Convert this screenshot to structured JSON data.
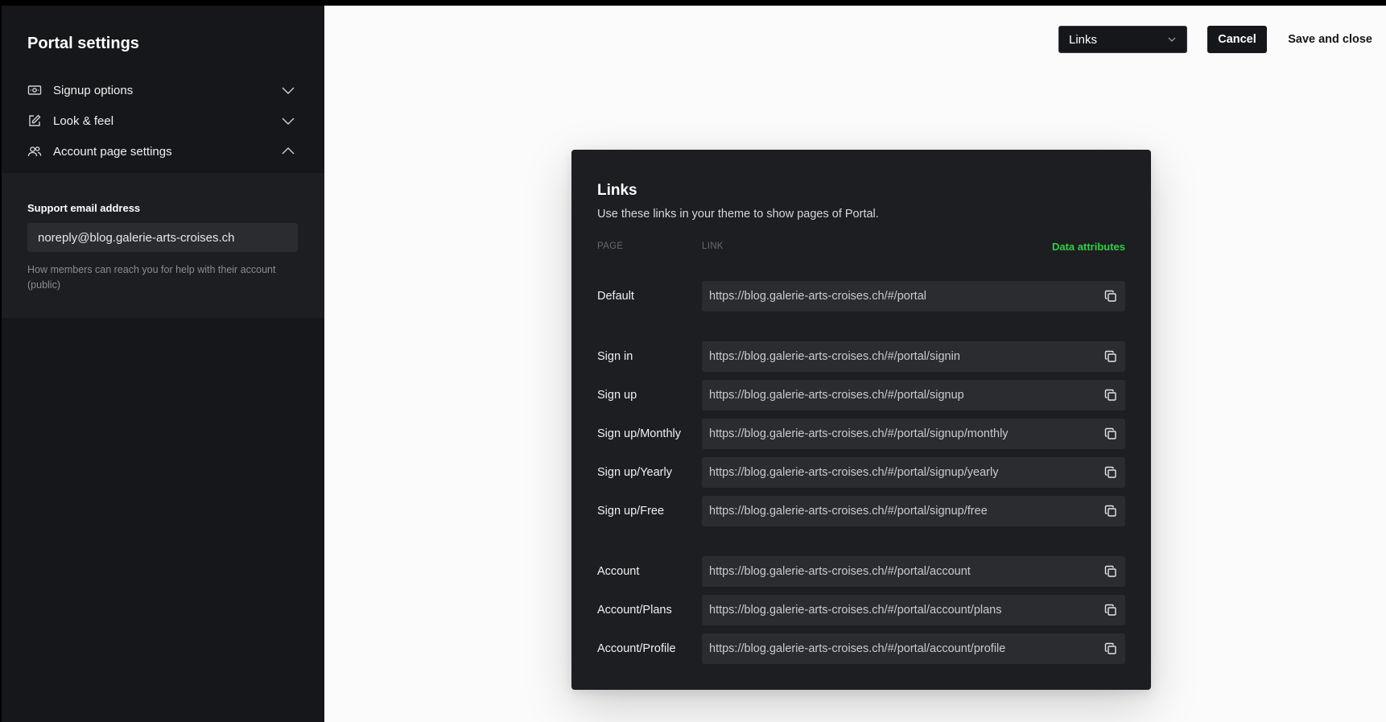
{
  "sidebar": {
    "title": "Portal settings",
    "items": [
      {
        "label": "Signup options",
        "icon": "card-icon",
        "expanded": false
      },
      {
        "label": "Look & feel",
        "icon": "edit-icon",
        "expanded": false
      },
      {
        "label": "Account page settings",
        "icon": "users-icon",
        "expanded": true
      }
    ],
    "support_email": {
      "label": "Support email address",
      "value": "noreply@blog.galerie-arts-croises.ch",
      "hint": "How members can reach you for help with their account (public)"
    }
  },
  "toolbar": {
    "select_value": "Links",
    "cancel_label": "Cancel",
    "save_label": "Save and close"
  },
  "modal": {
    "title": "Links",
    "subtitle": "Use these links in your theme to show pages of Portal.",
    "col_page": "PAGE",
    "col_link": "LINK",
    "data_attributes_label": "Data attributes",
    "links": [
      {
        "page": "Default",
        "url": "https://blog.galerie-arts-croises.ch/#/portal"
      },
      {
        "page": "Sign in",
        "url": "https://blog.galerie-arts-croises.ch/#/portal/signin"
      },
      {
        "page": "Sign up",
        "url": "https://blog.galerie-arts-croises.ch/#/portal/signup"
      },
      {
        "page": "Sign up/Monthly",
        "url": "https://blog.galerie-arts-croises.ch/#/portal/signup/monthly"
      },
      {
        "page": "Sign up/Yearly",
        "url": "https://blog.galerie-arts-croises.ch/#/portal/signup/yearly"
      },
      {
        "page": "Sign up/Free",
        "url": "https://blog.galerie-arts-croises.ch/#/portal/signup/free"
      },
      {
        "page": "Account",
        "url": "https://blog.galerie-arts-croises.ch/#/portal/account"
      },
      {
        "page": "Account/Plans",
        "url": "https://blog.galerie-arts-croises.ch/#/portal/account/plans"
      },
      {
        "page": "Account/Profile",
        "url": "https://blog.galerie-arts-croises.ch/#/portal/account/profile"
      }
    ]
  },
  "colors": {
    "sidebar_bg": "#15171a",
    "panel_bg": "#1c1e21",
    "accent_green": "#30cf43",
    "input_bg": "#2a2c30",
    "canvas_bg": "#fbfbfb"
  }
}
